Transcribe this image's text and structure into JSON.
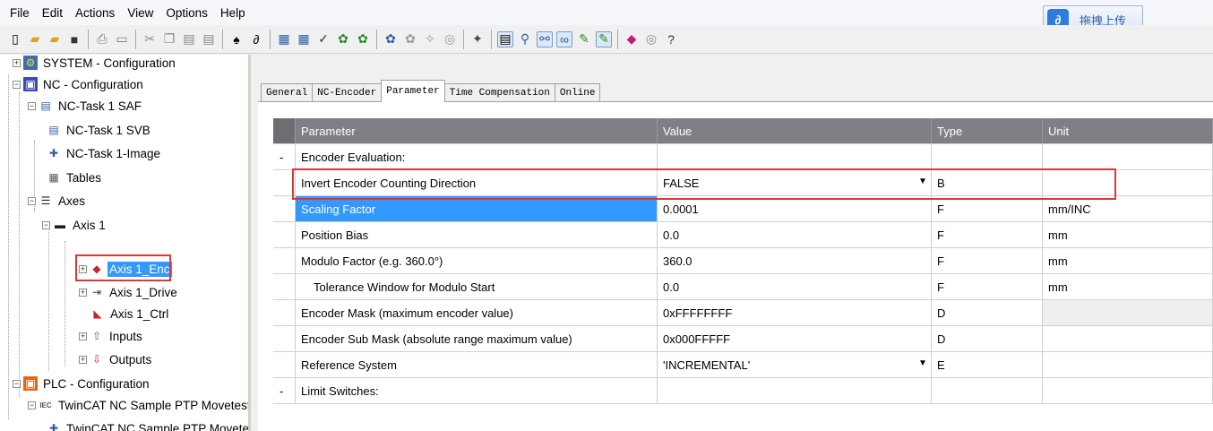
{
  "menu": [
    "File",
    "Edit",
    "Actions",
    "View",
    "Options",
    "Help"
  ],
  "upload": {
    "label": "拖拽上传"
  },
  "toolbar_icons": [
    "new-icon",
    "open-icon",
    "open-folder-icon",
    "save-icon",
    "print-icon",
    "print-preview-icon",
    "cut-icon",
    "copy-icon",
    "paste-icon",
    "paste-special-icon",
    "find-icon",
    "find-next-icon",
    "activate-config-icon",
    "set-run-mode-icon",
    "check-icon",
    "generate-mappings-icon",
    "restart-icon",
    "config-mode-icon",
    "free-run-icon",
    "scan-icon",
    "toggle-icon",
    "tree-icon",
    "zoom-icon",
    "link-icon",
    "online-icon",
    "scope-icon",
    "force-icon",
    "watch-icon",
    "info-icon",
    "help-icon"
  ],
  "tree": {
    "system": "SYSTEM - Configuration",
    "nc": "NC - Configuration",
    "nc_task": "NC-Task 1 SAF",
    "nc_task_svb": "NC-Task 1 SVB",
    "nc_task_image": "NC-Task 1-Image",
    "tables": "Tables",
    "axes": "Axes",
    "axis1": "Axis 1",
    "axis1_enc": "Axis 1_Enc",
    "axis1_drive": "Axis 1_Drive",
    "axis1_ctrl": "Axis 1_Ctrl",
    "inputs": "Inputs",
    "outputs": "Outputs",
    "plc": "PLC - Configuration",
    "twincat": "TwinCAT NC Sample PTP Movetest",
    "twincat2": "TwinCAT NC Sample PTP Movetest"
  },
  "tabs": [
    "General",
    "NC-Encoder",
    "Parameter",
    "Time Compensation",
    "Online"
  ],
  "grid": {
    "headers": [
      "Parameter",
      "Value",
      "Type",
      "Unit"
    ],
    "rows": [
      {
        "marker": "-",
        "param": "Encoder Evaluation:",
        "value": "",
        "type": "",
        "unit": ""
      },
      {
        "marker": "",
        "param": "Invert Encoder Counting Direction",
        "value": "FALSE",
        "type": "B",
        "unit": ""
      },
      {
        "marker": "",
        "param": "Scaling Factor",
        "value": "0.0001",
        "type": "F",
        "unit": "mm/INC"
      },
      {
        "marker": "",
        "param": "Position Bias",
        "value": "0.0",
        "type": "F",
        "unit": "mm"
      },
      {
        "marker": "",
        "param": "Modulo Factor (e.g. 360.0°)",
        "value": "360.0",
        "type": "F",
        "unit": "mm"
      },
      {
        "marker": "",
        "param": "Tolerance Window for Modulo Start",
        "value": "0.0",
        "type": "F",
        "unit": "mm"
      },
      {
        "marker": "",
        "param": "Encoder Mask (maximum encoder value)",
        "value": "0xFFFFFFFF",
        "type": "D",
        "unit": ""
      },
      {
        "marker": "",
        "param": "Encoder Sub Mask (absolute range maximum value)",
        "value": "0x000FFFFF",
        "type": "D",
        "unit": ""
      },
      {
        "marker": "",
        "param": "Reference System",
        "value": "'INCREMENTAL'",
        "type": "E",
        "unit": ""
      },
      {
        "marker": "-",
        "param": "Limit Switches:",
        "value": "",
        "type": "",
        "unit": ""
      }
    ]
  },
  "colors": {
    "selection": "#3399ff",
    "highlight": "#d9383a",
    "header": "#7f8085"
  }
}
